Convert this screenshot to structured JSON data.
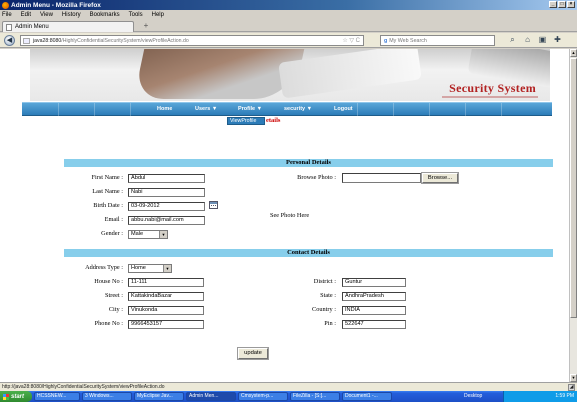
{
  "window": {
    "title": "Admin Menu - Mozilla Firefox",
    "controls": [
      "_",
      "□",
      "×"
    ]
  },
  "menubar": [
    "File",
    "Edit",
    "View",
    "History",
    "Bookmarks",
    "Tools",
    "Help"
  ],
  "tab": {
    "label": "Admin Menu",
    "new_tab": "+"
  },
  "nav": {
    "url_host": "java28:8080",
    "url_path": "/HighlyConfidentialSecuritySystem/viewProfileAction.do",
    "url_icons": "☆ ▽ C",
    "search_placeholder": "My Web Search",
    "search_brand": "g",
    "icons": [
      "search-icon",
      "home-icon",
      "bookmark-icon",
      "extension-icon"
    ]
  },
  "banner": {
    "brand": "Security System"
  },
  "menu": {
    "items": [
      "Home",
      "Users ▼",
      "Profile ▼",
      "security ▼",
      "Logout"
    ],
    "active": "Profile ▼",
    "dropdown": "ViewProfile"
  },
  "page_heading_fragment": "etails",
  "personal": {
    "heading": "Personal Details",
    "first_name_label": "First Name",
    "first_name": "Abdul",
    "last_name_label": "Last Name",
    "last_name": "Nabi",
    "birth_date_label": "Birth Date",
    "birth_date": "03-09-2012",
    "email_label": "Email",
    "email": "abbu.nabi@mail.com",
    "gender_label": "Gender",
    "gender": "Male",
    "browse_label": "Browse Photo",
    "browse_button": "Browse...",
    "photo_text": "See Photo Here"
  },
  "contact": {
    "heading": "Contact Details",
    "address_type_label": "Address Type",
    "address_type": "Home",
    "house_label": "House No",
    "house": "11-111",
    "street_label": "Street",
    "street": "KattakindaBazar",
    "city_label": "City",
    "city": "Vinukonda",
    "phone_label": "Phone No",
    "phone": "9966453157",
    "district_label": "District",
    "district": "Guntur",
    "state_label": "State",
    "state": "AndhraPradesh",
    "country_label": "Country",
    "country": "INDIA",
    "pin_label": "Pin",
    "pin": "522647"
  },
  "update_button": "update",
  "status_url": "http://java28:8080/HighlyConfidentialSecuritySystem/viewProfileAction.do",
  "taskbar": {
    "start": "start",
    "tasks": [
      "HCSSNEW...",
      "3 Windows...",
      "MyEclipse Jav...",
      "Admin Men...",
      "Cmsystem-p...",
      "FileZilla - [S:]...",
      "Document1 -..."
    ],
    "desktop": "Desktop",
    "clock": "1:59 PM"
  }
}
